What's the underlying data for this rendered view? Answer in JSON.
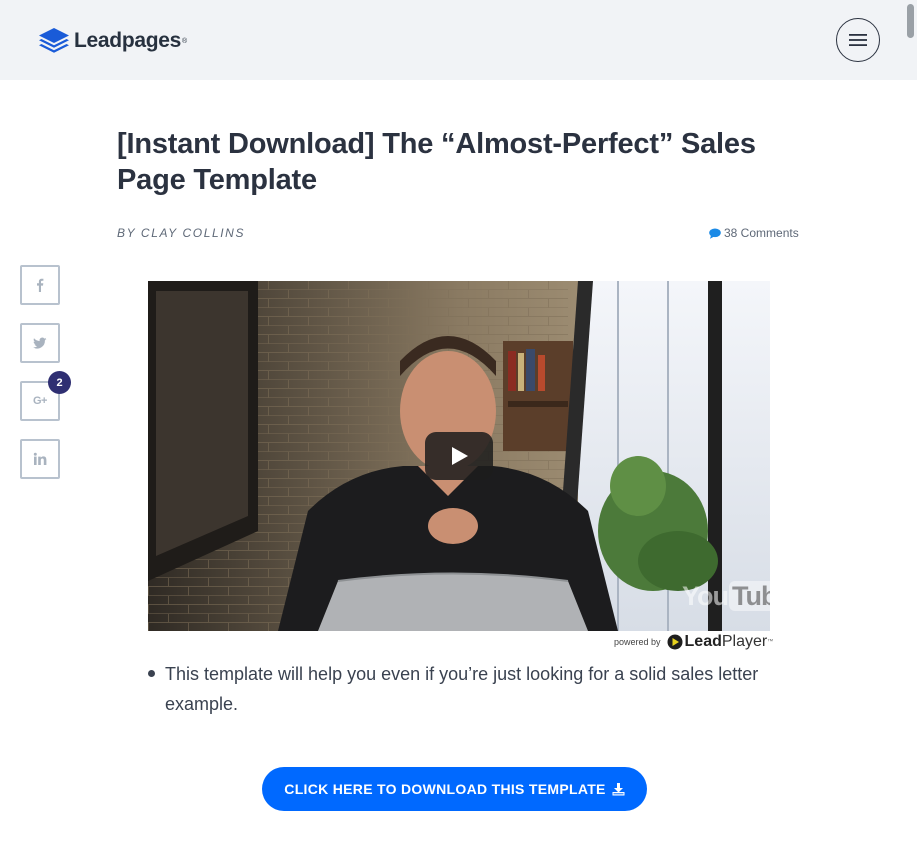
{
  "header": {
    "logo_text": "Leadpages",
    "logo_tm": "®",
    "menu_icon": "hamburger-menu-icon",
    "brand_color": "#1a5bd8"
  },
  "article": {
    "title": "[Instant Download] The “Almost-Perfect” Sales Page Template",
    "byline": "BY CLAY COLLINS",
    "comments": "38 Comments"
  },
  "social": {
    "items": [
      {
        "name": "facebook",
        "icon": "facebook-icon"
      },
      {
        "name": "twitter",
        "icon": "twitter-icon"
      },
      {
        "name": "google-plus",
        "icon": "google-plus-icon",
        "label": "G+",
        "count": "2"
      },
      {
        "name": "linkedin",
        "icon": "linkedin-icon"
      }
    ]
  },
  "video": {
    "watermark_you": "You",
    "watermark_tube": "Tube",
    "powered_by": "powered by",
    "player_brand_bold": "Lead",
    "player_brand_light": "Player",
    "player_tm": "™"
  },
  "bullets": [
    "This template will help you even if you’re just looking for a solid sales letter example."
  ],
  "cta": {
    "label": "CLICK HERE TO DOWNLOAD THIS TEMPLATE",
    "icon": "download-icon",
    "color": "#0069ff"
  }
}
